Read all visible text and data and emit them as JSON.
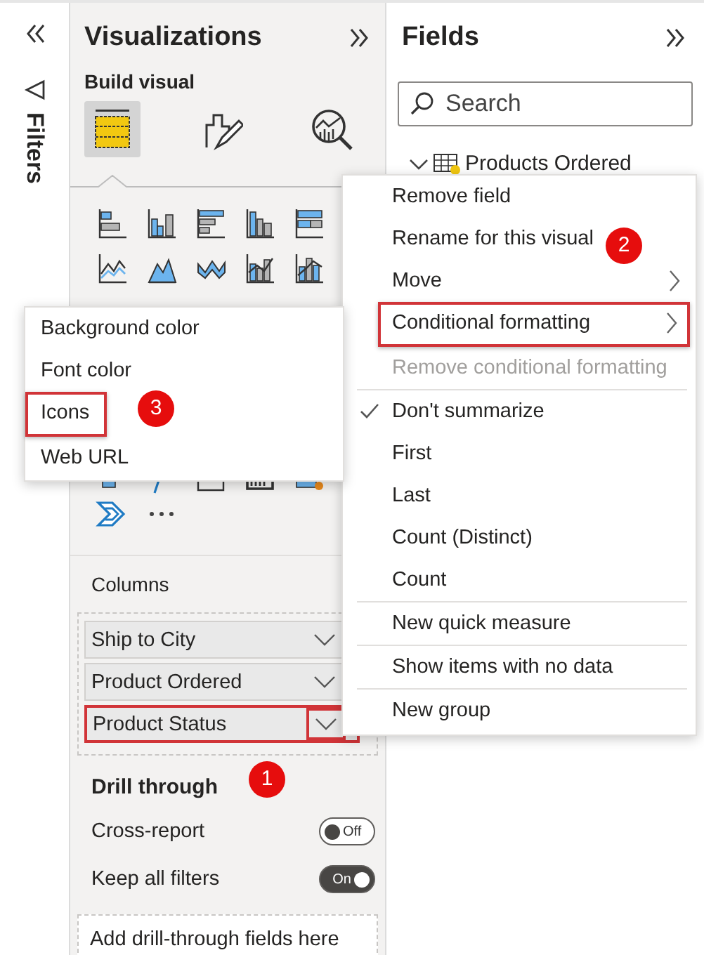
{
  "filters_pane": {
    "title": "Filters"
  },
  "visualizations_pane": {
    "title": "Visualizations",
    "section": "Build visual",
    "visual_tabs": [
      {
        "kind": "fields",
        "selected": true
      },
      {
        "kind": "format",
        "selected": false
      },
      {
        "kind": "analytics",
        "selected": false
      }
    ],
    "wells": {
      "title": "Columns",
      "fields": [
        {
          "label": "Ship to City",
          "highlighted": false
        },
        {
          "label": "Product Ordered",
          "highlighted": false
        },
        {
          "label": "Product Status",
          "highlighted": true,
          "callout": "1"
        }
      ]
    },
    "drill_through": {
      "title": "Drill through",
      "toggles": [
        {
          "label": "Cross-report",
          "on": false,
          "state_text": "Off"
        },
        {
          "label": "Keep all filters",
          "on": true,
          "state_text": "On"
        }
      ],
      "drop_zone": "Add drill-through fields here"
    }
  },
  "fields_pane": {
    "title": "Fields",
    "search": {
      "placeholder": "Search"
    },
    "tables": [
      {
        "name": "Products Ordered",
        "expanded": true
      }
    ]
  },
  "context_menu": {
    "groups": [
      [
        {
          "label": "Remove field",
          "disabled": false,
          "checked": false,
          "submenu": false,
          "highlighted": false
        },
        {
          "label": "Rename for this visual",
          "disabled": false,
          "checked": false,
          "submenu": false,
          "highlighted": false
        },
        {
          "label": "Move",
          "disabled": false,
          "checked": false,
          "submenu": true,
          "highlighted": false
        },
        {
          "label": "Conditional formatting",
          "disabled": false,
          "checked": false,
          "submenu": true,
          "highlighted": true,
          "callout": "2"
        },
        {
          "label": "Remove conditional formatting",
          "disabled": true,
          "checked": false,
          "submenu": false,
          "highlighted": false
        }
      ],
      [
        {
          "label": "Don't summarize",
          "disabled": false,
          "checked": true,
          "submenu": false,
          "highlighted": false
        },
        {
          "label": "First",
          "disabled": false,
          "checked": false,
          "submenu": false,
          "highlighted": false
        },
        {
          "label": "Last",
          "disabled": false,
          "checked": false,
          "submenu": false,
          "highlighted": false
        },
        {
          "label": "Count (Distinct)",
          "disabled": false,
          "checked": false,
          "submenu": false,
          "highlighted": false
        },
        {
          "label": "Count",
          "disabled": false,
          "checked": false,
          "submenu": false,
          "highlighted": false
        }
      ],
      [
        {
          "label": "New quick measure",
          "disabled": false,
          "checked": false,
          "submenu": false,
          "highlighted": false
        }
      ],
      [
        {
          "label": "Show items with no data",
          "disabled": false,
          "checked": false,
          "submenu": false,
          "highlighted": false
        }
      ],
      [
        {
          "label": "New group",
          "disabled": false,
          "checked": false,
          "submenu": false,
          "highlighted": false
        }
      ]
    ]
  },
  "submenu": {
    "items": [
      {
        "label": "Background color",
        "highlighted": false
      },
      {
        "label": "Font color",
        "highlighted": false
      },
      {
        "label": "Icons",
        "highlighted": true,
        "callout": "3"
      },
      {
        "label": "Web URL",
        "highlighted": false
      }
    ]
  }
}
